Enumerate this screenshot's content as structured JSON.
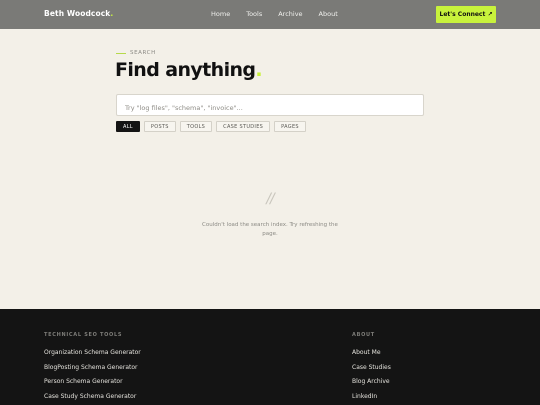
{
  "header": {
    "logo": "Beth Woodcock",
    "logo_dot": ".",
    "nav": [
      "Home",
      "Tools",
      "Archive",
      "About"
    ],
    "cta": "Let's Connect ↗"
  },
  "search": {
    "eyebrow": "SEARCH",
    "title": "Find anything",
    "title_dot": ".",
    "placeholder": "Try \"log files\", \"schema\", \"invoice\"...",
    "value": "",
    "filters": [
      "ALL",
      "POSTS",
      "TOOLS",
      "CASE STUDIES",
      "PAGES"
    ],
    "active_filter": "ALL"
  },
  "status": {
    "glyph": "//",
    "message": "Couldn't load the search index. Try refreshing the page."
  },
  "footer": {
    "tools_heading": "TECHNICAL SEO TOOLS",
    "tools": [
      "Organization Schema Generator",
      "BlogPosting Schema Generator",
      "Person Schema Generator",
      "Case Study Schema Generator"
    ],
    "about_heading": "ABOUT",
    "about": [
      "About Me",
      "Case Studies",
      "Blog Archive",
      "LinkedIn"
    ]
  },
  "colors": {
    "header_bg": "#7a7a77",
    "accent": "#c8f23c",
    "page_bg": "#f3f0e8",
    "footer_bg": "#141414"
  }
}
